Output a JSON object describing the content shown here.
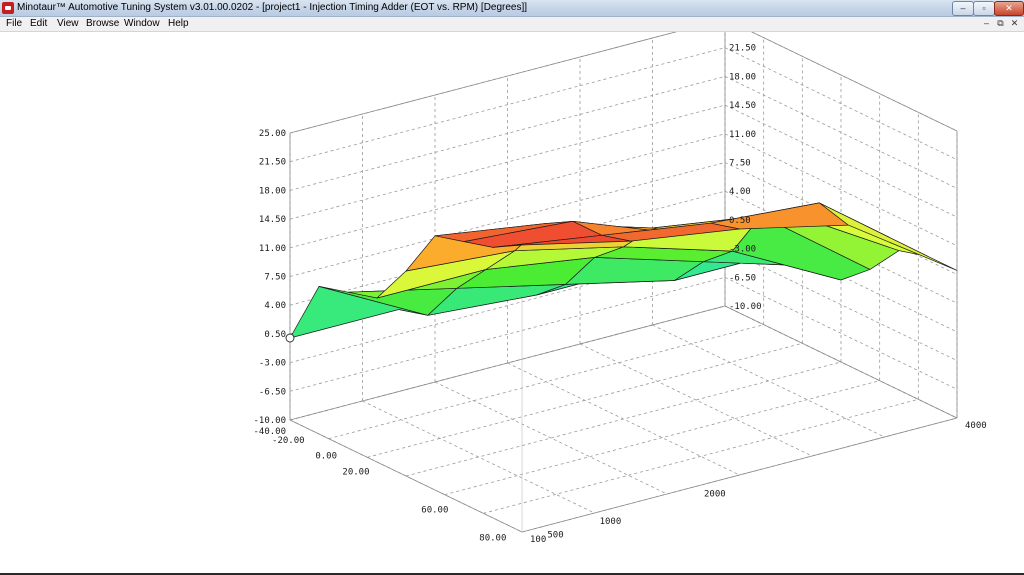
{
  "window": {
    "title": "Minotaur™ Automotive Tuning System  v3.01.00.0202 - [project1 - Injection Timing Adder (EOT vs. RPM) [Degrees]]",
    "controls": {
      "minimize": "–",
      "maximize": "▫",
      "close": "✕"
    }
  },
  "menu": {
    "items": [
      "File",
      "Edit",
      "View",
      "Browse",
      "Window",
      "Help"
    ],
    "mdi_controls": {
      "minimize": "–",
      "restore": "⧉",
      "close": "✕"
    }
  },
  "chart_data": {
    "type": "surface",
    "z_ticks": [
      "25.00",
      "21.50",
      "18.00",
      "14.50",
      "11.00",
      "7.50",
      "4.00",
      "0.50",
      "-3.00",
      "-6.50",
      "-10.00"
    ],
    "eot_ticks": [
      "-40.00",
      "-20.00",
      "0.00",
      "20.00",
      "60.00",
      "80.00"
    ],
    "rpm_ticks": [
      "4000",
      "2000",
      "1000",
      "500",
      "100"
    ],
    "zlim": [
      -10,
      25
    ],
    "eot_values": [
      -40,
      -20,
      -10,
      0,
      10,
      20,
      40,
      60,
      80
    ],
    "rpm_values": [
      100,
      500,
      1000,
      2000,
      4000
    ],
    "z_values": [
      [
        0,
        0,
        0,
        0,
        0
      ],
      [
        8,
        1,
        0,
        0,
        0
      ],
      [
        9,
        6,
        3,
        0,
        0
      ],
      [
        10,
        10,
        8,
        4,
        0
      ],
      [
        15,
        14,
        11,
        7,
        0
      ],
      [
        21,
        19,
        15,
        13,
        3
      ],
      [
        22,
        21,
        16,
        15,
        7
      ],
      [
        23,
        21,
        19,
        18,
        8
      ],
      [
        25,
        22,
        20,
        17,
        8
      ]
    ],
    "colors": {
      "low": "#2ee8a0",
      "mid": "#4cec30",
      "high_mid": "#d8fc3a",
      "high": "#fcb12c",
      "max": "#ee4a30"
    }
  }
}
